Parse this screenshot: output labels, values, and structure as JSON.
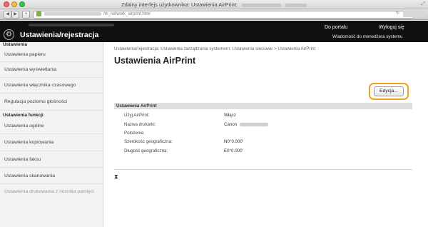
{
  "window": {
    "title": "Zdalny interfejs użytkownika: Ustawienia AirPrint:",
    "address": "/m_network_airprint.html"
  },
  "header": {
    "title": "Ustawienia/rejestracja",
    "portal_link": "Do portalu",
    "logout_link": "Wyloguj się",
    "message_link": "Wiadomość do menedżera systemu"
  },
  "sidebar": {
    "section1_heading": "Ustawienia",
    "section1_items": [
      {
        "label": "Ustawienia papieru"
      },
      {
        "label": "Ustawienia wyświetlania"
      },
      {
        "label": "Ustawienia włącznika czasowego"
      },
      {
        "label": "Regulacja poziomu głośności"
      }
    ],
    "section2_heading": "Ustawienia funkcji",
    "section2_items": [
      {
        "label": "Ustawienia ogólne"
      },
      {
        "label": "Ustawienia kopiowania"
      },
      {
        "label": "Ustawienia faksu"
      },
      {
        "label": "Ustawienia skanowania"
      },
      {
        "label": "Ustawienia drukowania z nośnika pamięci"
      }
    ]
  },
  "main": {
    "breadcrumb": "Ustawienia/rejestracja: Ustawienia zarządzania systemem: Ustawienia sieciowe > Ustawienia AirPrint",
    "page_title": "Ustawienia AirPrint",
    "edit_button": "Edycja...",
    "section_header": "Ustawienia AirPrint",
    "rows": [
      {
        "label": "Użyj AirPrint:",
        "value": "Włącz"
      },
      {
        "label": "Nazwa drukarki:",
        "value": "Canon"
      },
      {
        "label": "Położenie:",
        "value": ""
      },
      {
        "label": "Szerokość geograficzna:",
        "value": "N0°0.000'"
      },
      {
        "label": "Długość geograficzna:",
        "value": "E0°0.000'"
      }
    ],
    "top_link": "⧗"
  },
  "colors": {
    "header_bg": "#101010",
    "highlight": "#f0a21e",
    "section_bg": "#dedede"
  }
}
